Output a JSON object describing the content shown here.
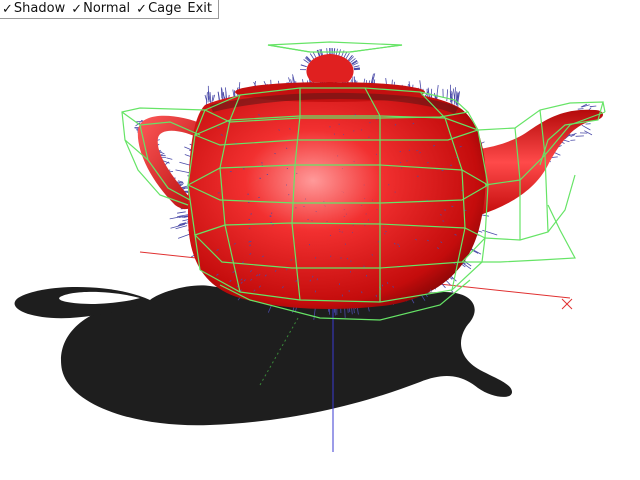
{
  "menu": {
    "items": [
      {
        "label": "Shadow",
        "checked": true,
        "check_glyph": "✓"
      },
      {
        "label": "Normal",
        "checked": true,
        "check_glyph": "✓"
      },
      {
        "label": "Cage",
        "checked": true,
        "check_glyph": "✓"
      }
    ],
    "exit_label": "Exit"
  },
  "scene": {
    "model": "teapot",
    "colors": {
      "background": "#ffffff",
      "surface": "#e81818",
      "surface_highlight": "#ff9a9a",
      "shadow": "#1e1e1e",
      "normals": "#4a4aa8",
      "cage": "#66e466",
      "axis_x": "#e03030",
      "axis_y": "#3a8a3a",
      "axis_z": "#3a3ad0"
    }
  }
}
